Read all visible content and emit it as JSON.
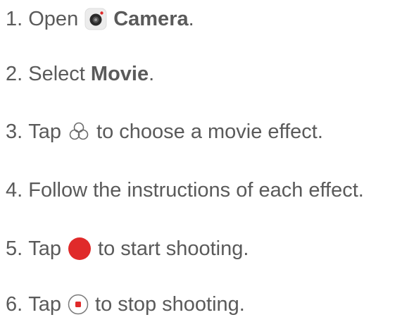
{
  "steps": [
    {
      "number": "1.",
      "before": "Open",
      "icon": "camera-app-icon",
      "bold": "Camera",
      "after": "."
    },
    {
      "number": "2.",
      "before": "Select",
      "bold": "Movie",
      "after": "."
    },
    {
      "number": "3.",
      "before": "Tap",
      "icon": "movie-effect-icon",
      "after": "to choose a movie effect."
    },
    {
      "number": "4.",
      "text": "Follow the instructions of each effect."
    },
    {
      "number": "5.",
      "before": "Tap",
      "icon": "record-button-icon",
      "after": "to start shooting."
    },
    {
      "number": "6.",
      "before": "Tap",
      "icon": "stop-button-icon",
      "after": "to stop shooting."
    }
  ],
  "colors": {
    "text": "#5a5a5a",
    "record_red": "#e02a2a",
    "camera_icon_bg": "#ececec"
  }
}
